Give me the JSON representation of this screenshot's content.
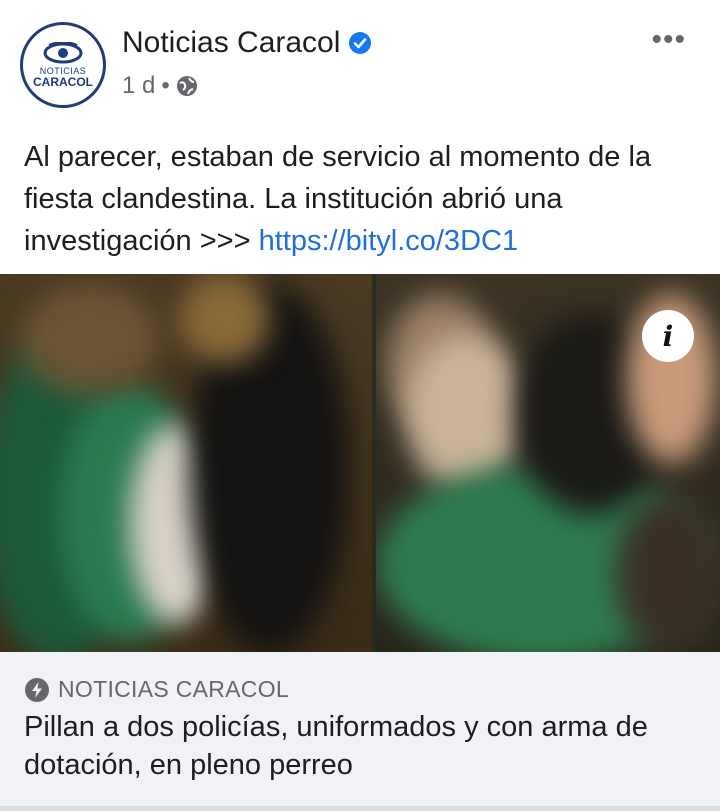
{
  "post": {
    "page_name": "Noticias Caracol",
    "time": "1 d",
    "separator": "•",
    "more_label": "•••",
    "avatar": {
      "top_text": "NOTICIAS",
      "bottom_text": "CARACOL"
    },
    "caption_text": "Al parecer, estaban de servicio al momento de la fiesta clandestina. La institución abrió una investigación >>> ",
    "caption_link": "https://bityl.co/3DC1",
    "icons": {
      "verified": "verified-badge-icon",
      "audience": "globe-icon",
      "more": "more-options-icon",
      "info": "info-icon",
      "source": "bolt-icon"
    },
    "info_label": "i"
  },
  "link_preview": {
    "source": "NOTICIAS CARACOL",
    "headline": "Pillan a dos policías, uniformados y con arma de dotación, en pleno perreo"
  },
  "colors": {
    "link": "#216fdb",
    "verified": "#1877f2",
    "brand": "#1f3d7a",
    "preview_bg": "#f0f2f5"
  }
}
